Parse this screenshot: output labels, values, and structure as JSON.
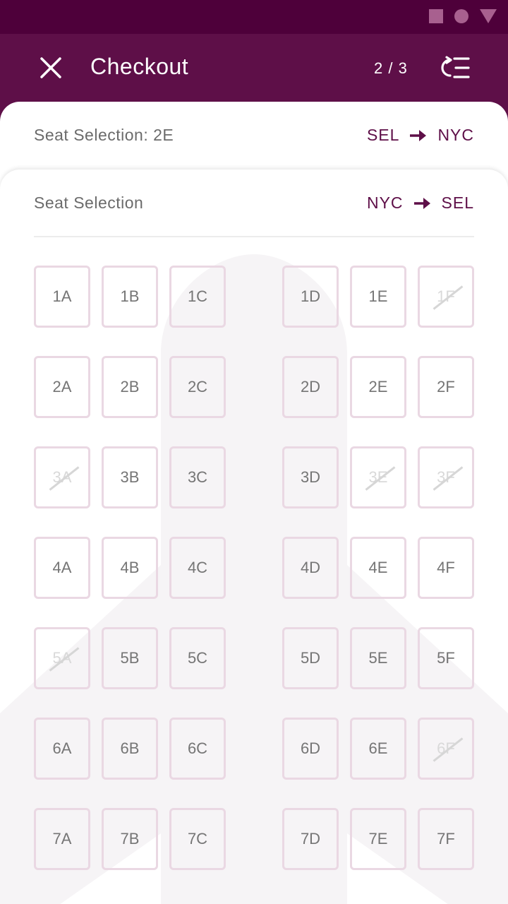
{
  "app_bar": {
    "title": "Checkout",
    "step": "2 / 3",
    "background": "#5e0f48",
    "status_background": "#4e003a"
  },
  "outbound": {
    "label": "Seat Selection: 2E",
    "from": "SEL",
    "to": "NYC",
    "arrow_icon": "arrow-right-icon"
  },
  "return": {
    "label": "Seat Selection",
    "from": "NYC",
    "to": "SEL",
    "arrow_icon": "arrow-right-icon"
  },
  "colors": {
    "accent": "#5e0f48",
    "seat_border": "#ead8e3",
    "seat_text": "#757575",
    "taken_text": "#d9d9d9",
    "plane_silhouette": "#f6f4f6"
  },
  "seats": {
    "columns_left": [
      "A",
      "B",
      "C"
    ],
    "columns_right": [
      "D",
      "E",
      "F"
    ],
    "rows": [
      {
        "row": "1",
        "seats": [
          {
            "id": "1A",
            "taken": false
          },
          {
            "id": "1B",
            "taken": false
          },
          {
            "id": "1C",
            "taken": false
          },
          {
            "id": "1D",
            "taken": false
          },
          {
            "id": "1E",
            "taken": false
          },
          {
            "id": "1F",
            "taken": true
          }
        ]
      },
      {
        "row": "2",
        "seats": [
          {
            "id": "2A",
            "taken": false
          },
          {
            "id": "2B",
            "taken": false
          },
          {
            "id": "2C",
            "taken": false
          },
          {
            "id": "2D",
            "taken": false
          },
          {
            "id": "2E",
            "taken": false
          },
          {
            "id": "2F",
            "taken": false
          }
        ]
      },
      {
        "row": "3",
        "seats": [
          {
            "id": "3A",
            "taken": true
          },
          {
            "id": "3B",
            "taken": false
          },
          {
            "id": "3C",
            "taken": false
          },
          {
            "id": "3D",
            "taken": false
          },
          {
            "id": "3E",
            "taken": true
          },
          {
            "id": "3F",
            "taken": true
          }
        ]
      },
      {
        "row": "4",
        "seats": [
          {
            "id": "4A",
            "taken": false
          },
          {
            "id": "4B",
            "taken": false
          },
          {
            "id": "4C",
            "taken": false
          },
          {
            "id": "4D",
            "taken": false
          },
          {
            "id": "4E",
            "taken": false
          },
          {
            "id": "4F",
            "taken": false
          }
        ]
      },
      {
        "row": "5",
        "seats": [
          {
            "id": "5A",
            "taken": true
          },
          {
            "id": "5B",
            "taken": false
          },
          {
            "id": "5C",
            "taken": false
          },
          {
            "id": "5D",
            "taken": false
          },
          {
            "id": "5E",
            "taken": false
          },
          {
            "id": "5F",
            "taken": false
          }
        ]
      },
      {
        "row": "6",
        "seats": [
          {
            "id": "6A",
            "taken": false
          },
          {
            "id": "6B",
            "taken": false
          },
          {
            "id": "6C",
            "taken": false
          },
          {
            "id": "6D",
            "taken": false
          },
          {
            "id": "6E",
            "taken": false
          },
          {
            "id": "6F",
            "taken": true
          }
        ]
      },
      {
        "row": "7",
        "seats": [
          {
            "id": "7A",
            "taken": false
          },
          {
            "id": "7B",
            "taken": false
          },
          {
            "id": "7C",
            "taken": false
          },
          {
            "id": "7D",
            "taken": false
          },
          {
            "id": "7E",
            "taken": false
          },
          {
            "id": "7F",
            "taken": false
          }
        ]
      }
    ]
  },
  "icons": {
    "close": "close-icon",
    "list": "list-refresh-icon",
    "status": [
      "square-icon",
      "circle-icon",
      "triangle-icon"
    ]
  }
}
